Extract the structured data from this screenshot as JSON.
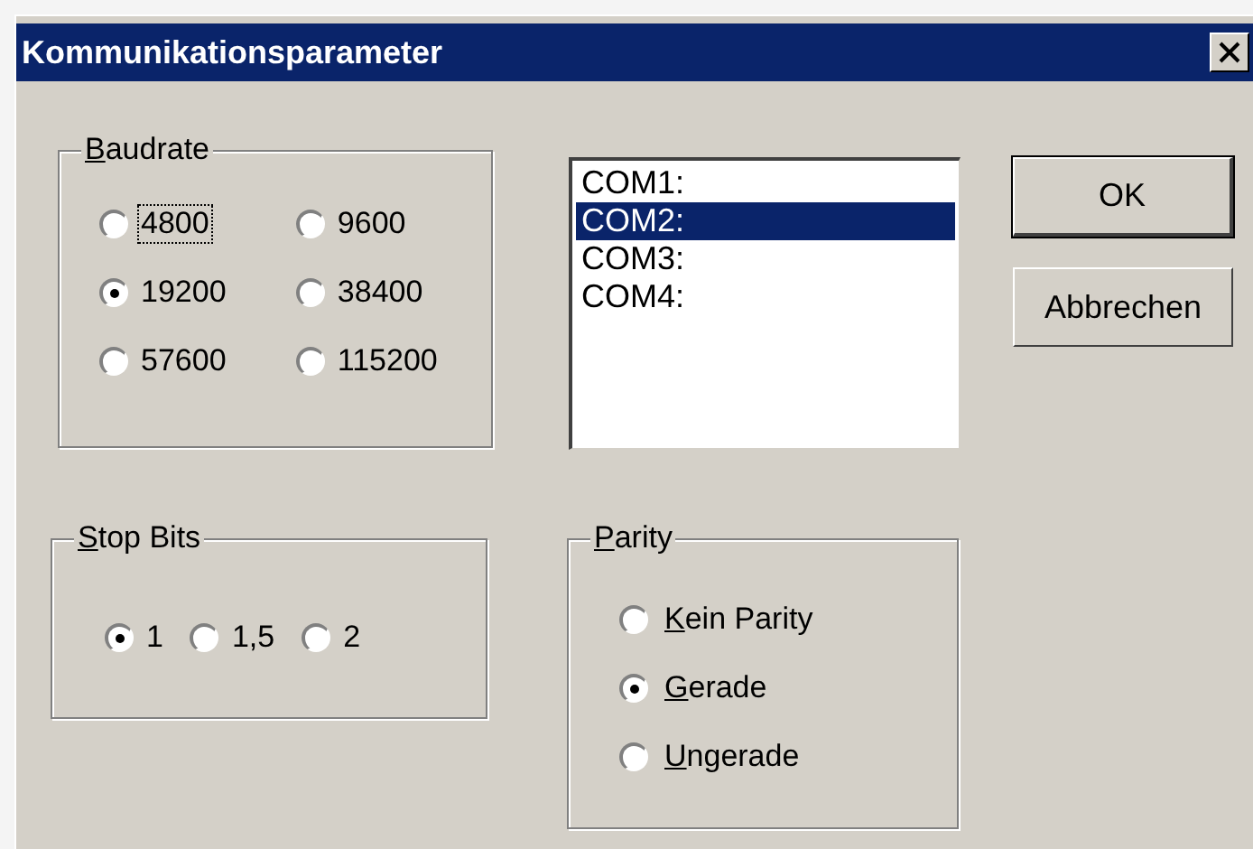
{
  "window": {
    "title": "Kommunikationsparameter"
  },
  "baudrate": {
    "label": "Baudrate",
    "mnemonic_first": true,
    "options": [
      {
        "label": "4800",
        "selected": false,
        "focused": true
      },
      {
        "label": "9600",
        "selected": false,
        "focused": false
      },
      {
        "label": "19200",
        "selected": true,
        "focused": false
      },
      {
        "label": "38400",
        "selected": false,
        "focused": false
      },
      {
        "label": "57600",
        "selected": false,
        "focused": false
      },
      {
        "label": "115200",
        "selected": false,
        "focused": false
      }
    ]
  },
  "ports": [
    {
      "label": "COM1:",
      "selected": false
    },
    {
      "label": "COM2:",
      "selected": true
    },
    {
      "label": "COM3:",
      "selected": false
    },
    {
      "label": "COM4:",
      "selected": false
    }
  ],
  "buttons": [
    {
      "label": "OK",
      "default": true
    },
    {
      "label": "Abbrechen",
      "default": false
    }
  ],
  "stop_bits": {
    "label": "Stop Bits",
    "mnemonic_first": true,
    "options": [
      {
        "label": "1",
        "selected": true
      },
      {
        "label": "1,5",
        "selected": false
      },
      {
        "label": "2",
        "selected": false
      }
    ]
  },
  "parity": {
    "label": "Parity",
    "mnemonic_first": true,
    "options": [
      {
        "label": "Kein Parity",
        "selected": false,
        "mnemonic_first": true
      },
      {
        "label": "Gerade",
        "selected": true,
        "mnemonic_first": true
      },
      {
        "label": "Ungerade",
        "selected": false,
        "mnemonic_first": true
      }
    ]
  }
}
